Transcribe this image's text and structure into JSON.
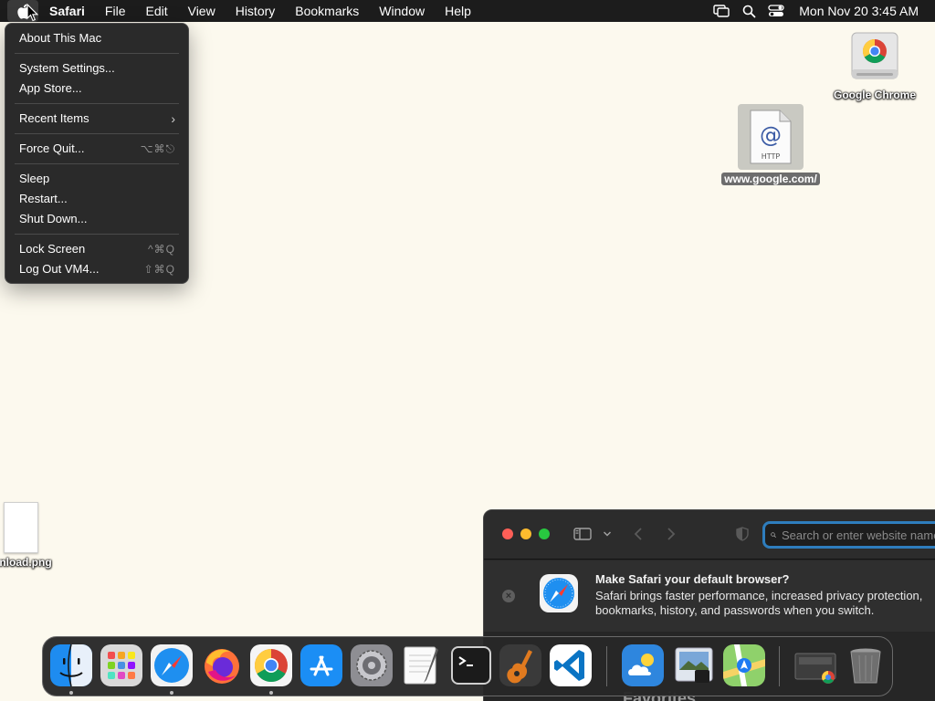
{
  "menubar": {
    "app_name": "Safari",
    "items": [
      "File",
      "Edit",
      "View",
      "History",
      "Bookmarks",
      "Window",
      "Help"
    ],
    "clock": "Mon Nov 20  3:45 AM",
    "status_icons": [
      "screen-mirroring-icon",
      "spotlight-search-icon",
      "control-center-icon"
    ]
  },
  "apple_menu": {
    "about": "About This Mac",
    "system_settings": "System Settings...",
    "app_store": "App Store...",
    "recent_items": "Recent Items",
    "force_quit": "Force Quit...",
    "force_quit_shortcut": "⌥⌘⎋",
    "sleep": "Sleep",
    "restart": "Restart...",
    "shut_down": "Shut Down...",
    "lock_screen": "Lock Screen",
    "lock_screen_shortcut": "^⌘Q",
    "log_out": "Log Out VM4...",
    "log_out_shortcut": "⇧⌘Q"
  },
  "desktop": {
    "chrome_label": "Google Chrome",
    "webloc_label": "www.google.com/",
    "webloc_badge": "HTTP",
    "png_label": "nload.png"
  },
  "safari": {
    "search_placeholder": "Search or enter website name",
    "banner_title": "Make Safari your default browser?",
    "banner_body": "Safari brings faster performance, increased privacy protection, bookmarks, history, and passwords when you switch.",
    "favorites_peek": "Favorites"
  },
  "dock": {
    "apps": [
      "Finder",
      "Launchpad",
      "Safari",
      "Firefox",
      "Google Chrome",
      "App Store",
      "System Settings",
      "TextEdit",
      "Terminal",
      "GarageBand",
      "Visual Studio Code",
      "Weather",
      "Preview",
      "Maps",
      "Downloads",
      "Trash"
    ],
    "running": [
      "Finder",
      "Safari",
      "Google Chrome"
    ]
  },
  "colors": {
    "menubar_bg": "#1c1c1c",
    "desktop_bg": "#fcf9ee",
    "menu_bg": "#2a2a2a",
    "address_focus": "#2e7dbd"
  }
}
